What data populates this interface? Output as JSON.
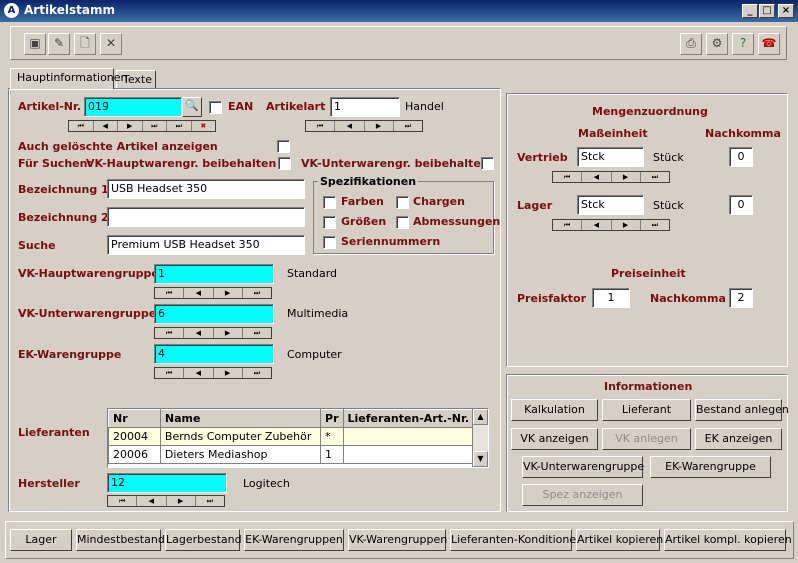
{
  "window": {
    "title": "Artikelstamm"
  },
  "tabs": [
    "Hauptinformationen",
    "Texte"
  ],
  "artikel": {
    "nr_label": "Artikel-Nr.",
    "nr_value": "019",
    "ean_label": "EAN",
    "art_label": "Artikelart",
    "art_value": "1",
    "art_text": "Handel",
    "geloeschte_label": "Auch gelöschte Artikel anzeigen",
    "fuer_suchen_label": "Für Suchen:",
    "vk_haupt_beibehalten": "VK-Hauptwarengr. beibehalten",
    "vk_unter_beibehalten": "VK-Unterwarengr. beibehalten",
    "bez1_label": "Bezeichnung 1",
    "bez1_value": "USB Headset 350",
    "bez2_label": "Bezeichnung 2",
    "bez2_value": "",
    "suche_label": "Suche",
    "suche_value": "Premium USB Headset 350"
  },
  "spezifikationen": {
    "title": "Spezifikationen",
    "farben": "Farben",
    "chargen": "Chargen",
    "groessen": "Größen",
    "abmessungen": "Abmessungen",
    "seriennummern": "Seriennummern"
  },
  "warengruppen": {
    "vk_haupt_label": "VK-Hauptwarengruppe",
    "vk_haupt_value": "1",
    "vk_haupt_text": "Standard",
    "vk_unter_label": "VK-Unterwarengruppe",
    "vk_unter_value": "6",
    "vk_unter_text": "Multimedia",
    "ek_label": "EK-Warengruppe",
    "ek_value": "4",
    "ek_text": "Computer"
  },
  "lieferanten": {
    "label": "Lieferanten",
    "columns": [
      "Nr",
      "Name",
      "Pr",
      "Lieferanten-Art.-Nr."
    ],
    "rows": [
      {
        "nr": "20004",
        "name": "Bernds Computer Zubehör",
        "pr": "*",
        "artnr": ""
      },
      {
        "nr": "20006",
        "name": "Dieters Mediashop",
        "pr": "1",
        "artnr": ""
      }
    ]
  },
  "hersteller": {
    "label": "Hersteller",
    "value": "12",
    "text": "Logitech"
  },
  "mengen": {
    "title": "Mengenzuordnung",
    "masseinheit": "Maßeinheit",
    "nachkomma": "Nachkomma",
    "vertrieb_label": "Vertrieb",
    "vertrieb_value": "Stck",
    "vertrieb_text": "Stück",
    "vertrieb_nk": "0",
    "lager_label": "Lager",
    "lager_value": "Stck",
    "lager_text": "Stück",
    "lager_nk": "0"
  },
  "preis": {
    "title": "Preiseinheit",
    "faktor_label": "Preisfaktor",
    "faktor_value": "1",
    "nachkomma_label": "Nachkomma",
    "nachkomma_value": "2"
  },
  "informationen": {
    "title": "Informationen",
    "kalkulation": "Kalkulation",
    "lieferant": "Lieferant",
    "bestand_anlegen": "Bestand anlegen",
    "vk_anzeigen": "VK anzeigen",
    "vk_anlegen": "VK anlegen",
    "ek_anzeigen": "EK anzeigen",
    "vk_unterwarengruppe": "VK-Unterwarengruppe",
    "ek_warengruppe": "EK-Warengruppe",
    "spez_anzeigen": "Spez anzeigen"
  },
  "bottom_buttons": [
    "Lager",
    "Mindestbestand",
    "Lagerbestand",
    "EK-Warengruppen",
    "VK-Warengruppen",
    "Lieferanten-Konditionen",
    "Artikel kopieren",
    "Artikel kompl. kopieren"
  ],
  "nav_glyphs": [
    "⏮",
    "◀",
    "▶",
    "⏭"
  ]
}
